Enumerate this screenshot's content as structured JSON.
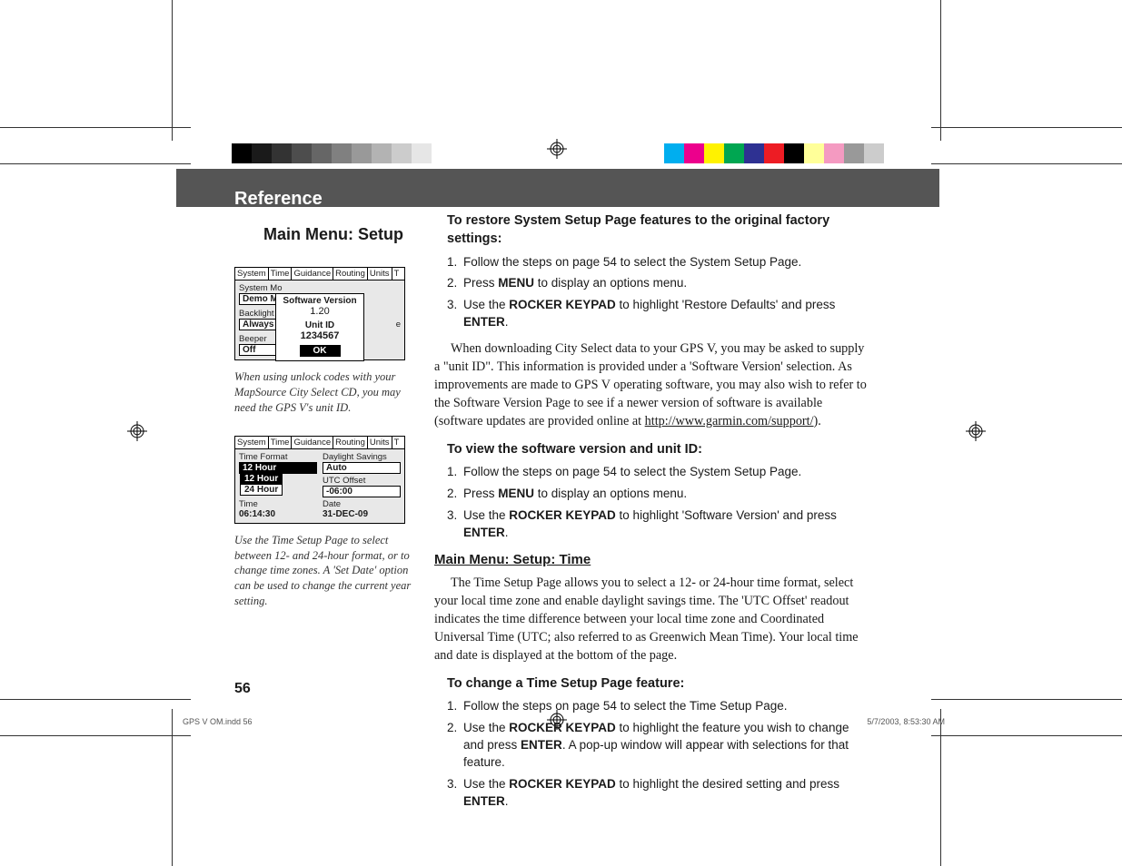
{
  "header": {
    "title": "Reference"
  },
  "subtitle": "Main Menu: Setup",
  "grayBar": [
    "#000",
    "#1a1a1a",
    "#333",
    "#4d4d4d",
    "#666",
    "#808080",
    "#999",
    "#b3b3b3",
    "#ccc",
    "#e6e6e6",
    "#fff"
  ],
  "colorBar": [
    "#00aeef",
    "#ec008c",
    "#fff200",
    "#00a651",
    "#2e3192",
    "#ed1c24",
    "#000000",
    "#ffff99",
    "#f49ac1",
    "#999999",
    "#cccccc"
  ],
  "screen1": {
    "tabs": [
      "System",
      "Time",
      "Guidance",
      "Routing",
      "Units",
      "T"
    ],
    "labels": {
      "sysmode": "System Mo",
      "demo": "Demo Mod",
      "backlight": "Backlight",
      "always": "Always On",
      "beeper": "Beeper",
      "off": "Off",
      "e": "e"
    },
    "popup": {
      "title": "Software Version",
      "version": "1.20",
      "unitIdLabel": "Unit ID",
      "unitId": "1234567",
      "ok": "OK"
    }
  },
  "caption1": "When using unlock codes with your MapSource City Select CD, you may need the GPS V's unit ID.",
  "screen2": {
    "tabs": [
      "System",
      "Time",
      "Guidance",
      "Routing",
      "Units",
      "T"
    ],
    "timeFormatLabel": "Time Format",
    "timeFormat": "12 Hour",
    "options": [
      "12 Hour",
      "24 Hour"
    ],
    "dstLabel": "Daylight Savings",
    "dst": "Auto",
    "utcLabel": "UTC Offset",
    "utc": "-06:00",
    "timeLabel": "Time",
    "time": "06:14:30",
    "dateLabel": "Date",
    "date": "31-DEC-09"
  },
  "caption2": "Use the Time Setup Page to select between 12- and 24-hour format, or to change time zones. A 'Set Date' option can be used to change the current year setting.",
  "instr1": {
    "head": "To restore System Setup Page features to the original factory settings:",
    "items": [
      {
        "n": "1.",
        "pre": "Follow the steps on page 54 to select the System Setup Page."
      },
      {
        "n": "2.",
        "pre": "Press ",
        "key": "MENU",
        "post": " to display an options menu."
      },
      {
        "n": "3.",
        "pre": "Use the ",
        "key": "ROCKER KEYPAD",
        "mid": " to highlight 'Restore Defaults' and press ",
        "key2": "ENTER",
        "post2": "."
      }
    ]
  },
  "para1a": "When downloading City Select data to your GPS V, you may be asked to supply a \"unit ID\".  This information is provided under a 'Software Version' selection.  As improvements are made to GPS V operating software, you may also wish to refer to the Software Version Page to see if a newer version of software is available (software updates are provided online at ",
  "para1link": "http://www.garmin.com/support/",
  "para1b": ").",
  "instr2": {
    "head": "To view the software version and unit ID:",
    "items": [
      {
        "n": "1.",
        "pre": "Follow the steps on page 54 to select the System Setup Page."
      },
      {
        "n": "2.",
        "pre": "Press ",
        "key": "MENU",
        "post": " to display an options menu."
      },
      {
        "n": "3.",
        "pre": "Use the ",
        "key": "ROCKER KEYPAD",
        "mid": " to highlight 'Software Version' and press ",
        "key2": "ENTER",
        "post2": "."
      }
    ]
  },
  "sectionHead": "Main Menu: Setup: Time",
  "para2": "The Time Setup Page allows you to select a 12- or 24-hour time format, select your local time zone and enable daylight savings time.  The 'UTC Offset' readout indicates the time difference between your local time zone and Coordinated Universal Time (UTC; also referred to as Greenwich Mean Time).  Your local time and date is displayed at the bottom of the page.",
  "instr3": {
    "head": "To change a Time Setup Page feature:",
    "items": [
      {
        "n": "1.",
        "pre": "Follow the steps on page 54 to select the Time Setup Page."
      },
      {
        "n": "2.",
        "pre": "Use the ",
        "key": "ROCKER KEYPAD",
        "mid": " to highlight the feature you wish to change and press ",
        "key2": "ENTER",
        "post2": ". A pop-up window will appear with selections for that feature."
      },
      {
        "n": "3.",
        "pre": "Use the ",
        "key": "ROCKER KEYPAD",
        "mid": " to highlight the desired setting and press ",
        "key2": "ENTER",
        "post2": "."
      }
    ]
  },
  "pageNum": "56",
  "footerLeft": "GPS V OM.indd   56",
  "footerRight": "5/7/2003, 8:53:30 AM"
}
